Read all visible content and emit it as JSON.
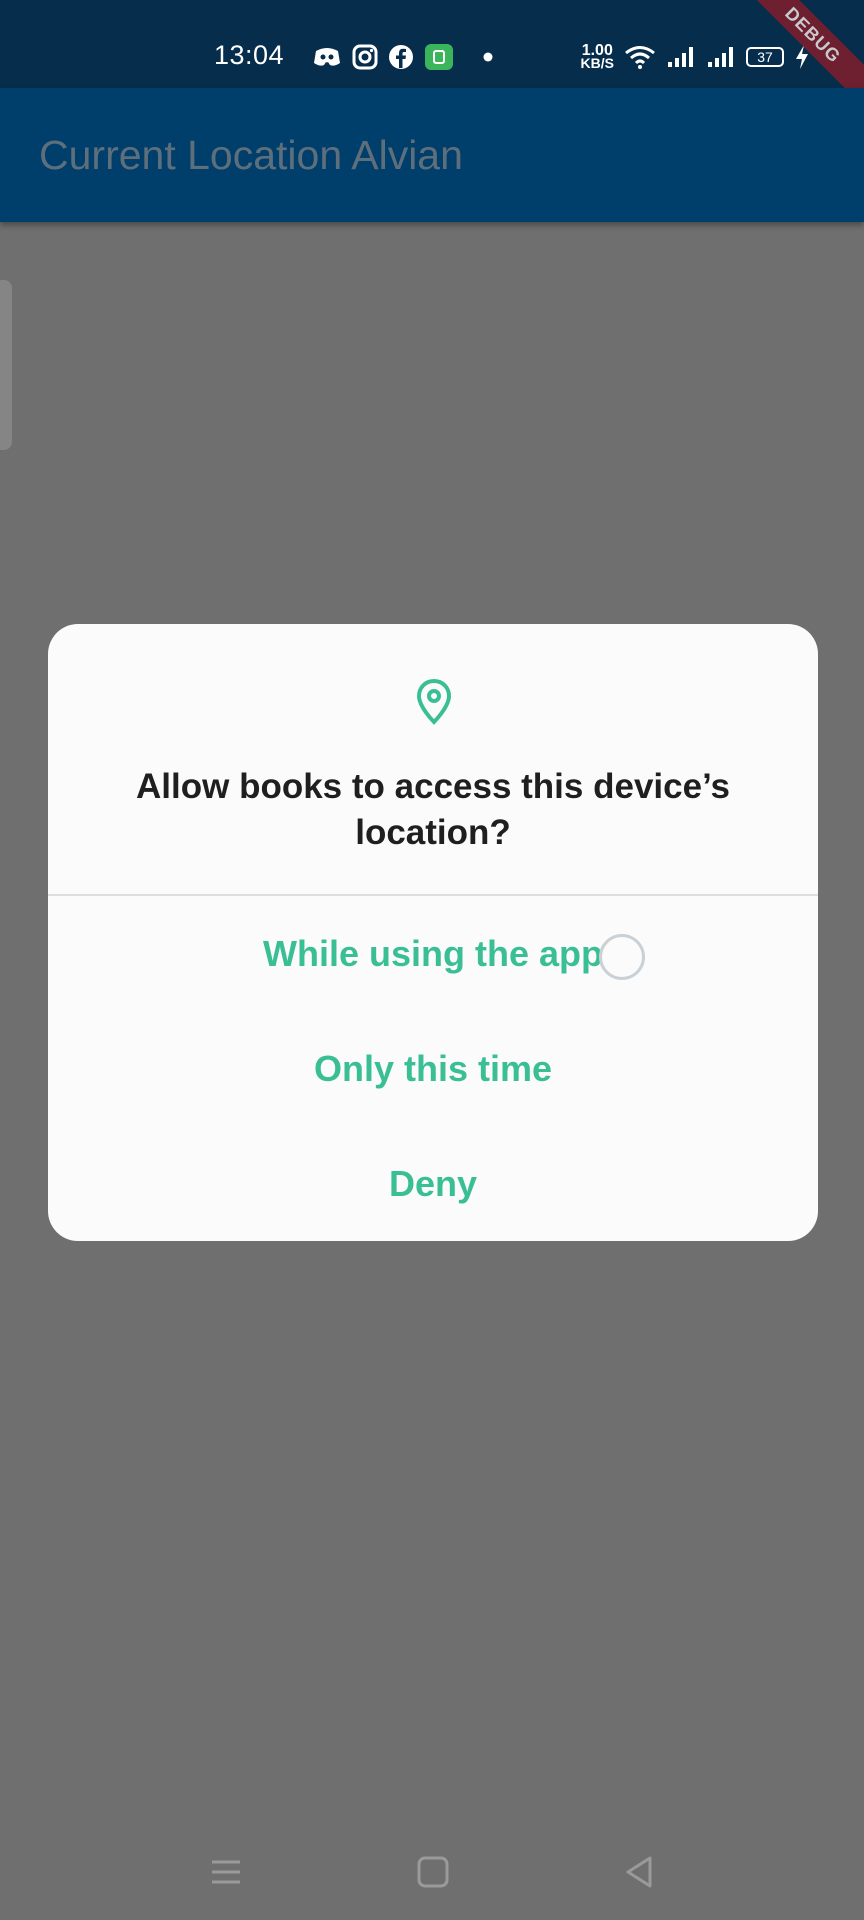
{
  "status_bar": {
    "time": "13:04",
    "net_speed_value": "1.00",
    "net_speed_unit": "KB/S",
    "battery": "37",
    "debug_label": "DEBUG",
    "icons": [
      "discord-icon",
      "instagram-icon",
      "facebook-icon",
      "app-badge-icon",
      "dot-icon",
      "wifi-icon",
      "signal-icon",
      "signal-icon",
      "charging-icon"
    ]
  },
  "app_bar": {
    "title": "Current Location Alvian"
  },
  "dialog": {
    "icon": "location-pin-icon",
    "title": "Allow books to access this device’s location?",
    "options": [
      {
        "label": "While using the app"
      },
      {
        "label": "Only this time"
      },
      {
        "label": "Deny"
      }
    ],
    "accent_color": "#3abf95"
  },
  "nav_bar": {
    "buttons": [
      "menu-icon",
      "home-icon",
      "back-icon"
    ]
  },
  "colors": {
    "status_bar": "#072d4c",
    "app_bar": "#003e6b",
    "scrim_background": "#6f6f6f",
    "dialog_background": "#fbfbfb"
  }
}
